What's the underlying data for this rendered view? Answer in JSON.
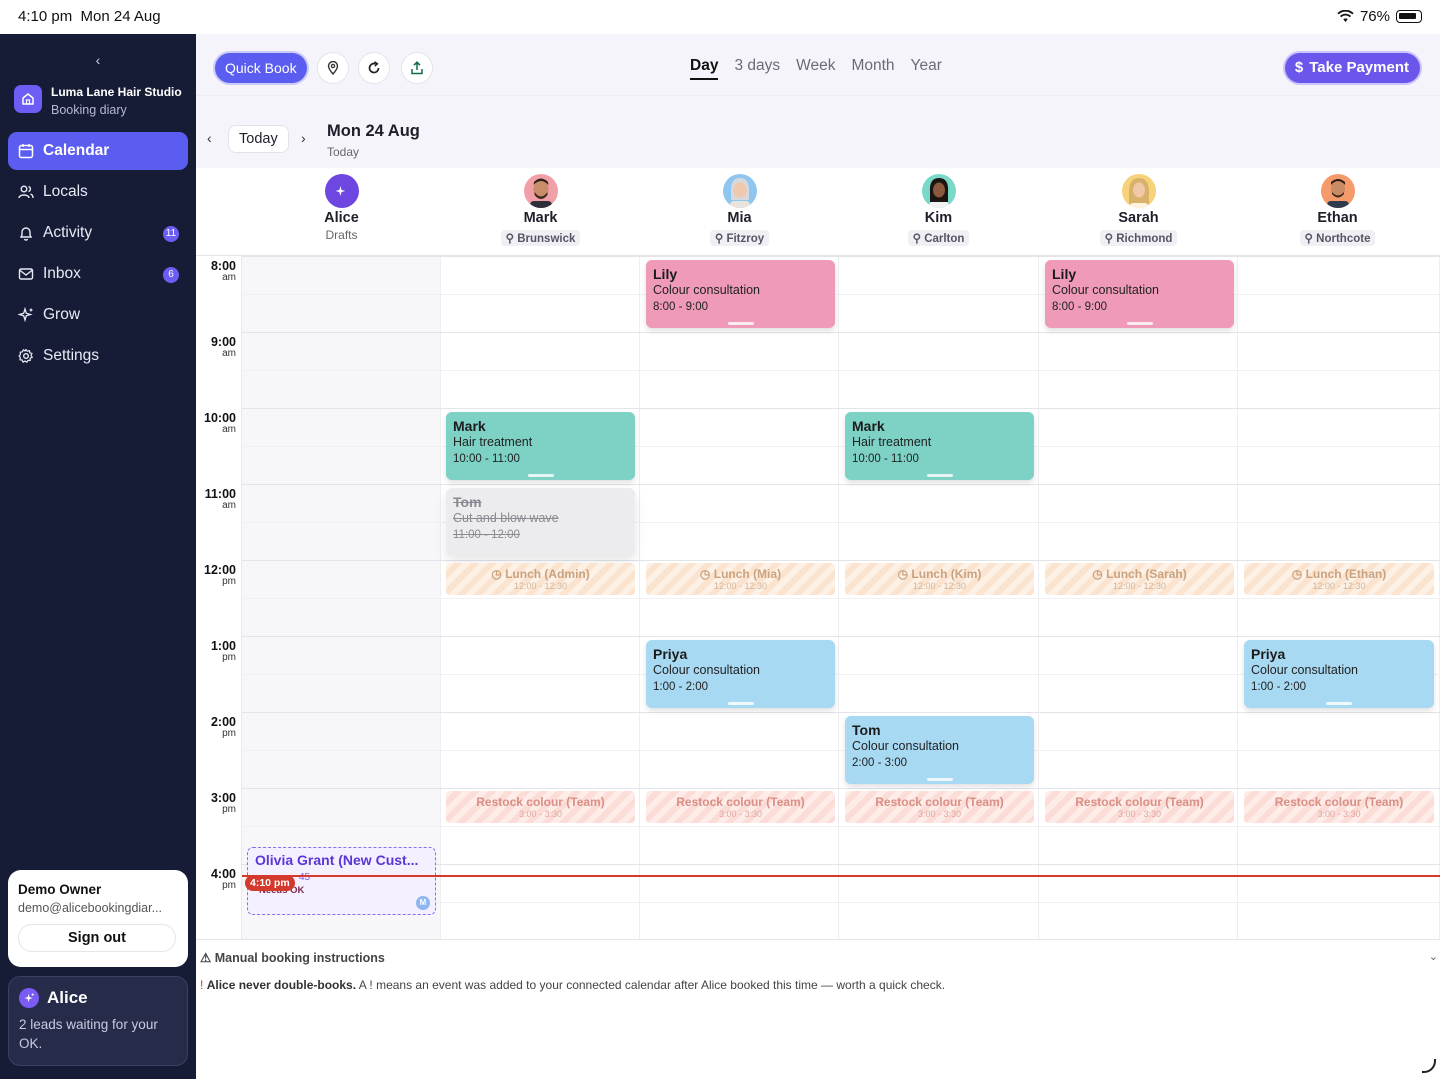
{
  "status_bar": {
    "time": "4:10 pm",
    "date": "Mon 24 Aug",
    "battery": "76%"
  },
  "sidebar": {
    "collapse_icon": "chevron-left-icon",
    "studio": {
      "name": "Luma Lane Hair Studio",
      "subtitle": "Booking diary"
    },
    "items": [
      {
        "label": "Calendar",
        "icon": "calendar-icon",
        "active": true,
        "badge": ""
      },
      {
        "label": "Locals",
        "icon": "people-icon",
        "active": false,
        "badge": ""
      },
      {
        "label": "Activity",
        "icon": "bell-icon",
        "active": false,
        "badge": "11"
      },
      {
        "label": "Inbox",
        "icon": "mail-icon",
        "active": false,
        "badge": "6"
      },
      {
        "label": "Grow",
        "icon": "sparkle-icon",
        "active": false,
        "badge": ""
      },
      {
        "label": "Settings",
        "icon": "gear-icon",
        "active": false,
        "badge": ""
      }
    ],
    "user": {
      "name": "Demo Owner",
      "email": "demo@alicebookingdiar...",
      "signout_label": "Sign out"
    },
    "assistant": {
      "name": "Alice",
      "message": "2 leads waiting for your OK."
    }
  },
  "toolbar": {
    "quick_book_label": "Quick Book",
    "views": [
      "Day",
      "3 days",
      "Week",
      "Month",
      "Year"
    ],
    "active_view": "Day",
    "take_payment_label": "Take Payment"
  },
  "date_nav": {
    "today_label": "Today",
    "date_title": "Mon 24 Aug",
    "date_sub": "Today"
  },
  "staff": [
    {
      "name": "Alice",
      "sub": "Drafts",
      "location": ""
    },
    {
      "name": "Mark",
      "sub": "",
      "location": "Brunswick"
    },
    {
      "name": "Mia",
      "sub": "",
      "location": "Fitzroy"
    },
    {
      "name": "Kim",
      "sub": "",
      "location": "Carlton"
    },
    {
      "name": "Sarah",
      "sub": "",
      "location": "Richmond"
    },
    {
      "name": "Ethan",
      "sub": "",
      "location": "Northcote"
    }
  ],
  "time_labels": [
    {
      "time": "8:00",
      "ampm": "am"
    },
    {
      "time": "9:00",
      "ampm": "am"
    },
    {
      "time": "10:00",
      "ampm": "am"
    },
    {
      "time": "11:00",
      "ampm": "am"
    },
    {
      "time": "12:00",
      "ampm": "pm"
    },
    {
      "time": "1:00",
      "ampm": "pm"
    },
    {
      "time": "2:00",
      "ampm": "pm"
    },
    {
      "time": "3:00",
      "ampm": "pm"
    },
    {
      "time": "4:00",
      "ampm": "pm"
    }
  ],
  "appointments": [
    {
      "staff_index": 2,
      "client": "Lily",
      "service": "Colour consultation",
      "time": "8:00 - 9:00",
      "color": "pink",
      "cancelled": false
    },
    {
      "staff_index": 4,
      "client": "Lily",
      "service": "Colour consultation",
      "time": "8:00 - 9:00",
      "color": "pink",
      "cancelled": false
    },
    {
      "staff_index": 1,
      "client": "Mark",
      "service": "Hair treatment",
      "time": "10:00 - 11:00",
      "color": "teal",
      "cancelled": false
    },
    {
      "staff_index": 3,
      "client": "Mark",
      "service": "Hair treatment",
      "time": "10:00 - 11:00",
      "color": "teal",
      "cancelled": false
    },
    {
      "staff_index": 1,
      "client": "Tom",
      "service": "Cut and blow wave",
      "time": "11:00 - 12:00",
      "color": "ghost",
      "cancelled": true
    },
    {
      "staff_index": 2,
      "client": "Priya",
      "service": "Colour consultation",
      "time": "1:00 - 2:00",
      "color": "blue",
      "cancelled": false
    },
    {
      "staff_index": 5,
      "client": "Priya",
      "service": "Colour consultation",
      "time": "1:00 - 2:00",
      "color": "blue",
      "cancelled": false
    },
    {
      "staff_index": 3,
      "client": "Tom",
      "service": "Colour consultation",
      "time": "2:00 - 3:00",
      "color": "blue",
      "cancelled": false
    }
  ],
  "blocks": [
    {
      "staff_index": 1,
      "label": "Lunch (Admin)",
      "time": "12:00 - 12:30",
      "kind": "lunch"
    },
    {
      "staff_index": 2,
      "label": "Lunch (Mia)",
      "time": "12:00 - 12:30",
      "kind": "lunch"
    },
    {
      "staff_index": 3,
      "label": "Lunch (Kim)",
      "time": "12:00 - 12:30",
      "kind": "lunch"
    },
    {
      "staff_index": 4,
      "label": "Lunch (Sarah)",
      "time": "12:00 - 12:30",
      "kind": "lunch"
    },
    {
      "staff_index": 5,
      "label": "Lunch (Ethan)",
      "time": "12:00 - 12:30",
      "kind": "lunch"
    },
    {
      "staff_index": 1,
      "label": "Restock colour (Team)",
      "time": "3:00 - 3:30",
      "kind": "restock"
    },
    {
      "staff_index": 2,
      "label": "Restock colour (Team)",
      "time": "3:00 - 3:30",
      "kind": "restock"
    },
    {
      "staff_index": 3,
      "label": "Restock colour (Team)",
      "time": "3:00 - 3:30",
      "kind": "restock"
    },
    {
      "staff_index": 4,
      "label": "Restock colour (Team)",
      "time": "3:00 - 3:30",
      "kind": "restock"
    },
    {
      "staff_index": 5,
      "label": "Restock colour (Team)",
      "time": "3:00 - 3:30",
      "kind": "restock"
    }
  ],
  "draft": {
    "client": "Olivia Grant (New Cust...",
    "time": "45",
    "status": "Needs OK",
    "initial": "M"
  },
  "now": {
    "label": "4:10 pm"
  },
  "footer": {
    "title": "Manual booking instructions",
    "note_bold": "Alice never double-books.",
    "note_rest": "A ! means an event was added to your connected calendar after Alice booked this time — worth a quick check."
  },
  "colors": {
    "accent": "#5b5cf0",
    "sidebar": "#171c36",
    "pink": "#ee9ab8",
    "teal": "#7dd1c5",
    "blue": "#a8d9f2",
    "now_line": "#d33a2c"
  }
}
